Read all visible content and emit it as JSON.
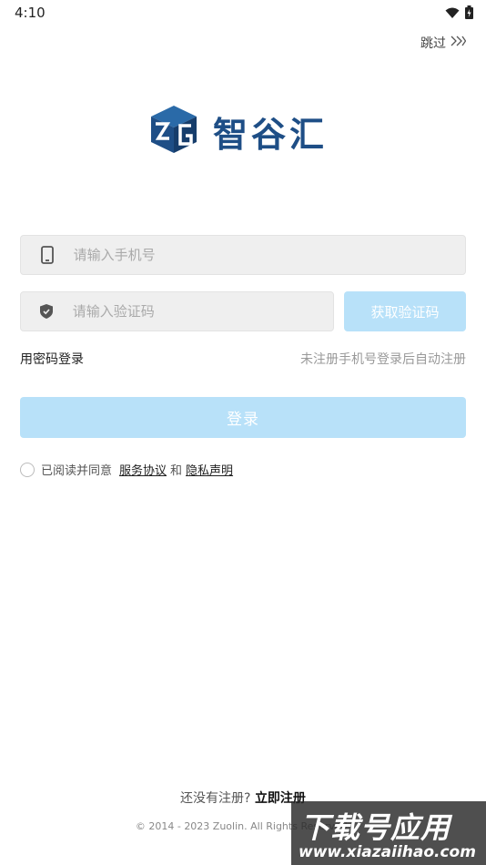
{
  "status_bar": {
    "time": "4:10"
  },
  "header": {
    "skip_label": "跳过"
  },
  "brand": {
    "name": "智谷汇",
    "color": "#1e4e86"
  },
  "form": {
    "phone_placeholder": "请输入手机号",
    "code_placeholder": "请输入验证码",
    "get_code_label": "获取验证码",
    "password_login_label": "用密码登录",
    "auto_register_hint": "未注册手机号登录后自动注册",
    "login_label": "登录"
  },
  "agreement": {
    "prefix": "已阅读并同意",
    "terms_label": "服务协议",
    "and": "和",
    "privacy_label": "隐私声明"
  },
  "footer": {
    "register_prompt": "还没有注册?",
    "register_link": "立即注册",
    "copyright": "© 2014 - 2023 Zuolin. All Rights Reserved."
  },
  "watermark": {
    "title": "下载号应用",
    "url": "www.xiazaiihao.com"
  },
  "colors": {
    "accent_light": "#b8e1f9",
    "field_bg": "#efefef"
  }
}
